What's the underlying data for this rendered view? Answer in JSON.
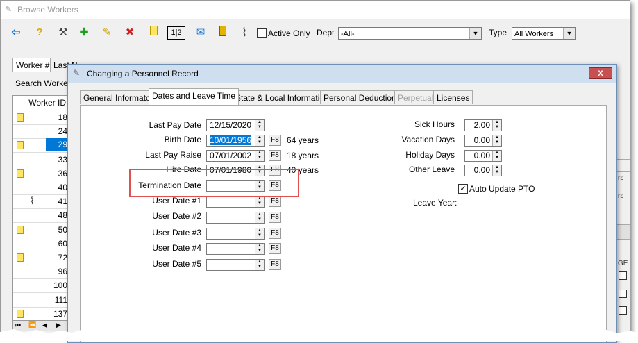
{
  "outer_window": {
    "title": "Browse Workers"
  },
  "toolbar": {
    "active_only_label": "Active Only",
    "dept_label": "Dept",
    "dept_value": "-All-",
    "type_label": "Type",
    "type_value": "All Workers"
  },
  "outer_tabs": [
    "Worker #",
    "Last N"
  ],
  "search_label": "Search Worker #",
  "grid": {
    "header": "Worker ID",
    "rows": [
      {
        "id": "18",
        "icon": "note"
      },
      {
        "id": "24",
        "icon": ""
      },
      {
        "id": "29",
        "icon": "note",
        "selected": true
      },
      {
        "id": "33",
        "icon": ""
      },
      {
        "id": "36",
        "icon": "note"
      },
      {
        "id": "40",
        "icon": ""
      },
      {
        "id": "41",
        "icon": "clip"
      },
      {
        "id": "48",
        "icon": ""
      },
      {
        "id": "50",
        "icon": "note"
      },
      {
        "id": "60",
        "icon": ""
      },
      {
        "id": "72",
        "icon": "note"
      },
      {
        "id": "96",
        "icon": ""
      },
      {
        "id": "100",
        "icon": ""
      },
      {
        "id": "111",
        "icon": ""
      },
      {
        "id": "137",
        "icon": "note"
      }
    ]
  },
  "modal": {
    "title": "Changing a Personnel Record",
    "close": "X",
    "tabs": [
      {
        "label": "General Informaton"
      },
      {
        "label": "Dates and Leave Time",
        "active": true
      },
      {
        "label": "State & Local Information"
      },
      {
        "label": "Personal Deductions"
      },
      {
        "label": "Perpetual",
        "disabled": true
      },
      {
        "label": "Licenses"
      }
    ],
    "dates": {
      "last_pay_date": {
        "label": "Last Pay Date",
        "value": "12/15/2020"
      },
      "birth_date": {
        "label": "Birth Date",
        "value": "10/01/1956",
        "years": "64 years"
      },
      "last_pay_raise": {
        "label": "Last Pay Raise",
        "value": "07/01/2002",
        "years": "18 years"
      },
      "hire_date": {
        "label": "Hire Date",
        "value": "07/01/1980",
        "years": "40 years"
      },
      "termination_date": {
        "label": "Termination Date",
        "value": ""
      },
      "user_date_1": {
        "label": "User Date #1",
        "value": ""
      },
      "user_date_2": {
        "label": "User Date #2",
        "value": ""
      },
      "user_date_3": {
        "label": "User Date #3",
        "value": ""
      },
      "user_date_4": {
        "label": "User Date #4",
        "value": ""
      },
      "user_date_5": {
        "label": "User Date #5",
        "value": ""
      },
      "f8": "F8"
    },
    "leave": {
      "sick_hours": {
        "label": "Sick Hours",
        "value": "2.00"
      },
      "vacation_days": {
        "label": "Vacation Days",
        "value": "0.00"
      },
      "holiday_days": {
        "label": "Holiday Days",
        "value": "0.00"
      },
      "other_leave": {
        "label": "Other Leave",
        "value": "0.00"
      },
      "auto_update_label": "Auto Update PTO",
      "auto_update_checked": true,
      "leave_year_label": "Leave Year:"
    }
  },
  "partial_right": {
    "col_a": "rs",
    "col_b": "rs",
    "col_c": "GE"
  },
  "colors": {
    "accent": "#0078d7",
    "highlight_box": "#e05050",
    "modal_title": "#cfdff0"
  }
}
